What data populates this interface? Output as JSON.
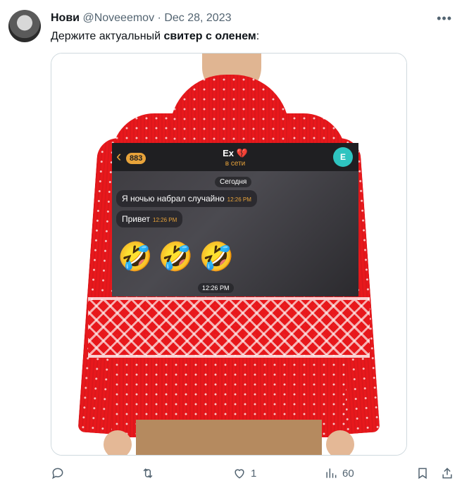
{
  "tweet": {
    "author_name": "Нови",
    "handle": "@Noveeemov",
    "separator": "·",
    "date": "Dec 28, 2023",
    "text_plain": "Держите актуальный ",
    "text_bold": "свитер с оленем",
    "text_end": ":"
  },
  "chat": {
    "back_count": "883",
    "contact_name": "Ex 💔",
    "status": "в сети",
    "avatar_letter": "E",
    "date_label": "Сегодня",
    "messages": [
      {
        "text": "Я ночью набрал случайно",
        "time": "12:26 PM"
      },
      {
        "text": "Привет",
        "time": "12:26 PM"
      }
    ],
    "emojis": "🤣🤣🤣",
    "last_time": "12:26 PM"
  },
  "actions": {
    "reply_count": "",
    "retweet_count": "",
    "like_count": "1",
    "views_count": "60"
  },
  "colors": {
    "sweater_red": "#e8181c",
    "chat_accent": "#e8a33a",
    "meta_gray": "#536471"
  }
}
